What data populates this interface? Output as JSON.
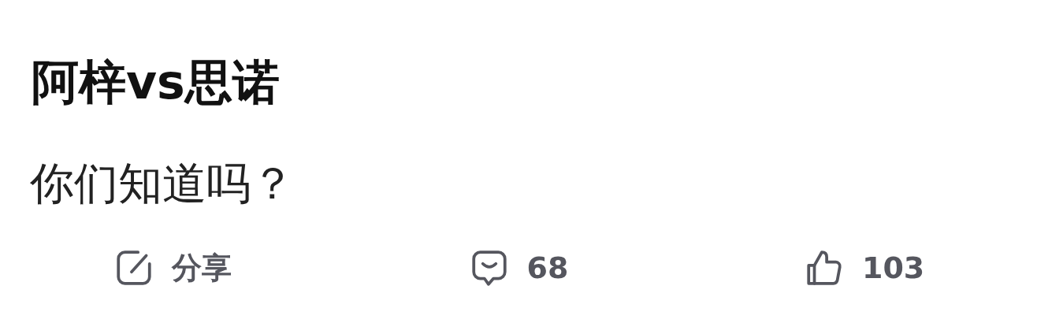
{
  "post": {
    "title": "阿梓vs思诺",
    "body": "你们知道吗？"
  },
  "actions": [
    {
      "kind": "share",
      "label": "分享"
    },
    {
      "kind": "comment",
      "label": "68"
    },
    {
      "kind": "like",
      "label": "103"
    }
  ]
}
